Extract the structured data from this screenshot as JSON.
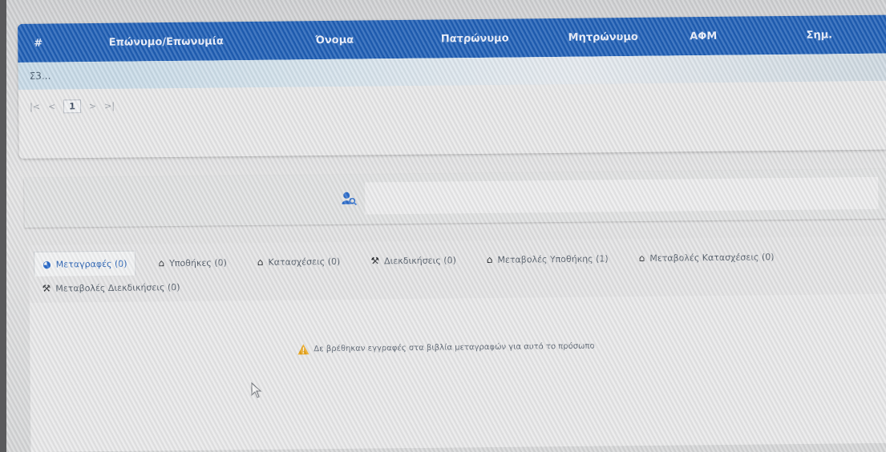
{
  "table": {
    "columns": [
      "#",
      "Επώνυμο/Επωνυμία",
      "Όνομα",
      "Πατρώνυμο",
      "Μητρώνυμο",
      "ΑΦΜ",
      "Σημ."
    ],
    "row": {
      "first_cell": "Σ3..."
    }
  },
  "pager": {
    "first": "|<",
    "prev": "<",
    "current": "1",
    "next": ">",
    "last": ">|"
  },
  "tabs": [
    {
      "label": "Μεταγραφές (0)",
      "icon": "pie-chart-icon",
      "active": true
    },
    {
      "label": "Υποθήκες (0)",
      "icon": "house-icon",
      "active": false
    },
    {
      "label": "Κατασχέσεις (0)",
      "icon": "house-icon",
      "active": false
    },
    {
      "label": "Διεκδικήσεις (0)",
      "icon": "gavel-icon",
      "active": false
    },
    {
      "label": "Μεταβολές Υποθήκης (1)",
      "icon": "house-icon",
      "active": false
    },
    {
      "label": "Μεταβολές Κατασχέσεις (0)",
      "icon": "house-icon",
      "active": false
    },
    {
      "label": "Μεταβολές Διεκδικήσεις (0)",
      "icon": "gavel-icon",
      "active": false
    }
  ],
  "alert": {
    "text": "Δε βρέθηκαν εγγραφές στα βιβλία μεταγραφών για αυτό το πρόσωπο",
    "icon": "warning-icon"
  },
  "colors": {
    "header_blue": "#1f5fb6",
    "row_highlight": "#c8dbe8",
    "active_tab_text": "#2e67b8",
    "warning": "#e8a317"
  }
}
